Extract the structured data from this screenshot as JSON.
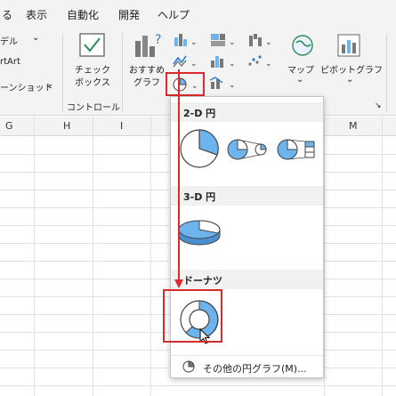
{
  "menubar": {
    "items": [
      {
        "label": "る"
      },
      {
        "label": "表示"
      },
      {
        "label": "自動化"
      },
      {
        "label": "開発"
      },
      {
        "label": "ヘルプ"
      }
    ]
  },
  "ribbon": {
    "left_items": [
      "デル",
      "rtArt",
      "ーンショット"
    ],
    "checkbox_label_1": "チェック",
    "checkbox_label_2": "ボックス",
    "control_group_label": "コントロール",
    "recommended_label_1": "おすすめ",
    "recommended_label_2": "グラフ",
    "map_label": "マップ",
    "pivot_label": "ピボットグラフ"
  },
  "sheet": {
    "columns": [
      "G",
      "H",
      "I",
      "M"
    ]
  },
  "dropdown": {
    "section_2d": "2-D 円",
    "section_3d": "3-D 円",
    "section_donut": "ドーナツ",
    "more_label": "その他の円グラフ(M)..."
  },
  "colors": {
    "accent_blue": "#6cb4ee",
    "highlight_red": "#d92b2b"
  }
}
